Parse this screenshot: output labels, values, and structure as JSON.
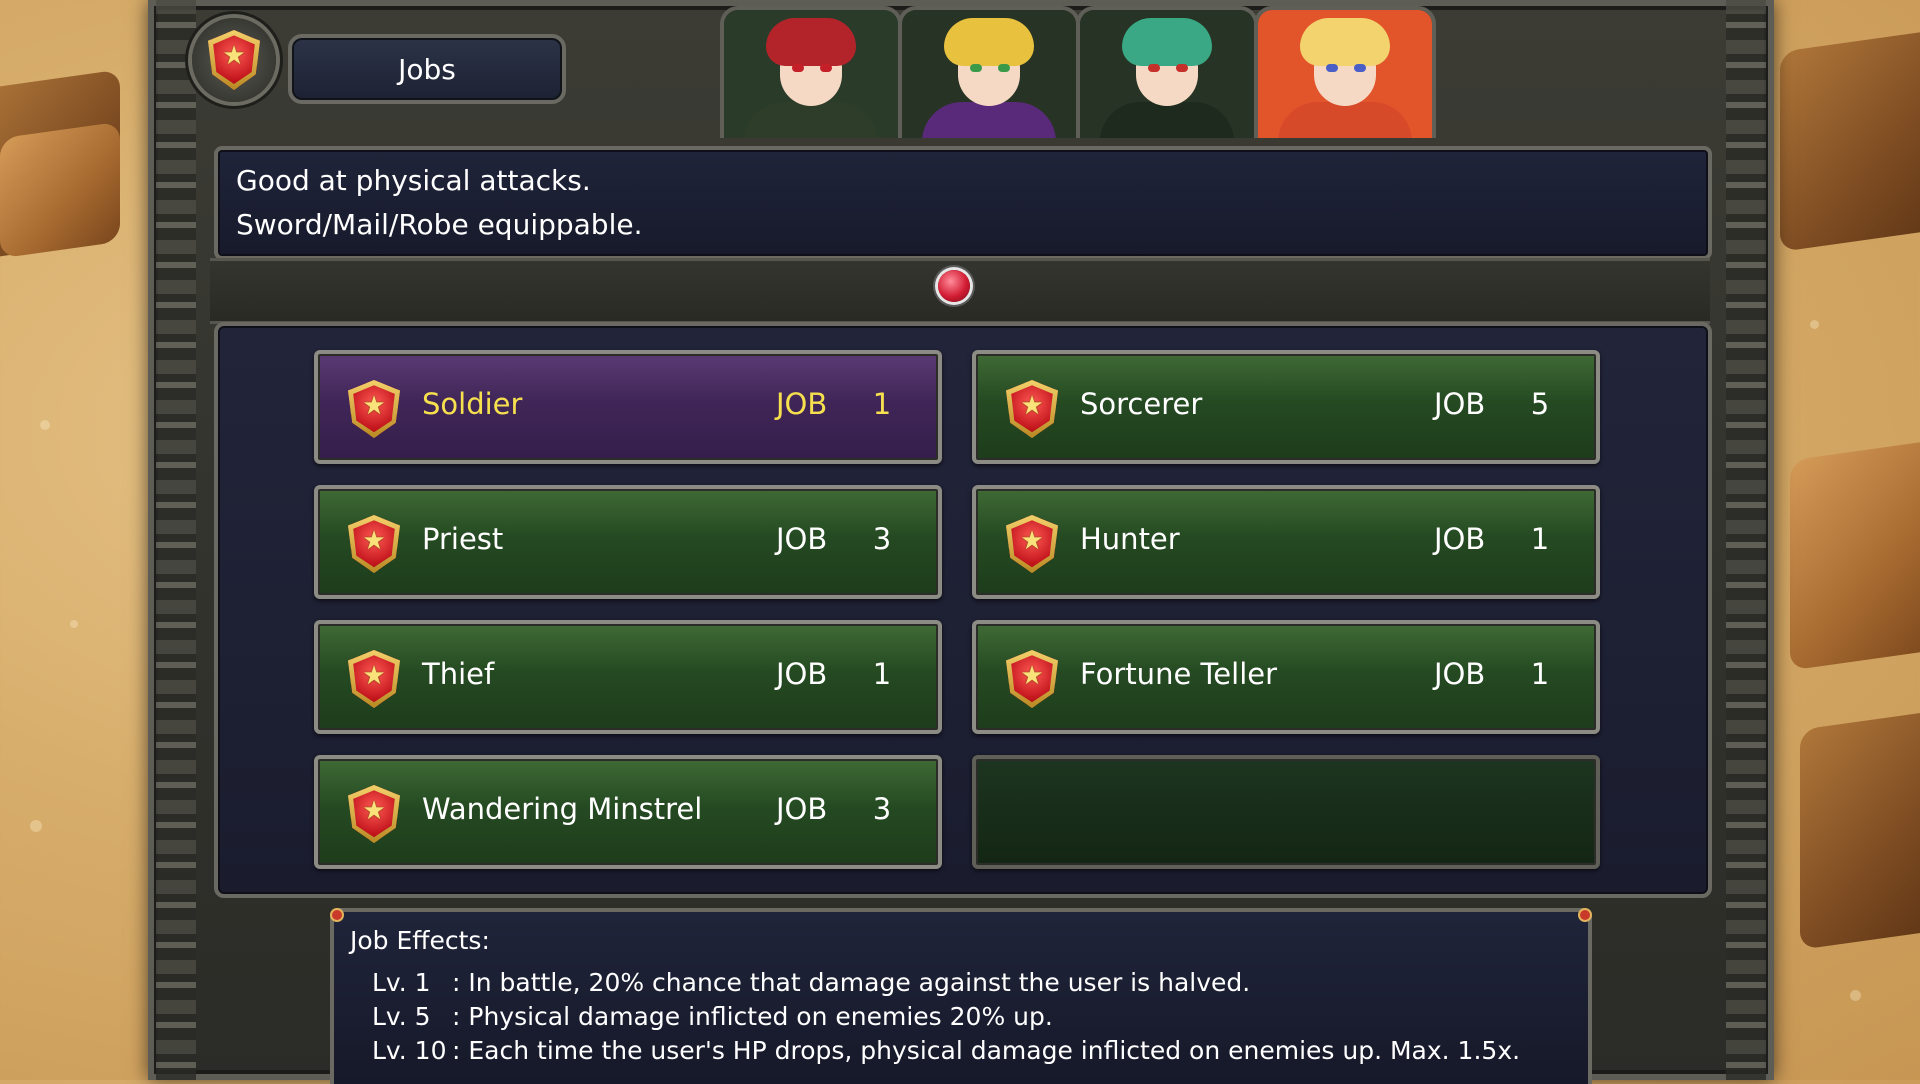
{
  "window": {
    "title": "Jobs"
  },
  "party": [
    {
      "name": "red-haired-hero-portrait",
      "hair": "#b3242a",
      "eye": "#c5202a",
      "outfit": "#2d3d2a",
      "bg": "#2a3b2a"
    },
    {
      "name": "blonde-knight-portrait",
      "hair": "#e8c13e",
      "eye": "#3a9a4a",
      "outfit": "#5a2a7a",
      "bg": "#263325"
    },
    {
      "name": "green-haired-mage-portrait",
      "hair": "#3aa884",
      "eye": "#c5302a",
      "outfit": "#1f2a1e",
      "bg": "#263325"
    },
    {
      "name": "blonde-girl-portrait",
      "hair": "#f2d36e",
      "eye": "#4a5fc5",
      "outfit": "#d64a2a",
      "bg": "#e2542a"
    }
  ],
  "description": {
    "line1": "Good at physical attacks.",
    "line2": "Sword/Mail/Robe equippable."
  },
  "jobs": [
    {
      "name": "Soldier",
      "label": "JOB",
      "level": "1",
      "selected": true
    },
    {
      "name": "Sorcerer",
      "label": "JOB",
      "level": "5",
      "selected": false
    },
    {
      "name": "Priest",
      "label": "JOB",
      "level": "3",
      "selected": false
    },
    {
      "name": "Hunter",
      "label": "JOB",
      "level": "1",
      "selected": false
    },
    {
      "name": "Thief",
      "label": "JOB",
      "level": "1",
      "selected": false
    },
    {
      "name": "Fortune Teller",
      "label": "JOB",
      "level": "1",
      "selected": false
    },
    {
      "name": "Wandering Minstrel",
      "label": "JOB",
      "level": "3",
      "selected": false
    }
  ],
  "effects": {
    "heading": "Job Effects:",
    "rows": [
      {
        "lv": "Lv. 1",
        "text": ": In battle, 20% chance that damage against the user is halved."
      },
      {
        "lv": "Lv. 5",
        "text": ": Physical damage inflicted on enemies 20% up."
      },
      {
        "lv": "Lv. 10",
        "text": ": Each time the user's HP drops, physical damage inflicted on enemies up. Max. 1.5x."
      }
    ]
  },
  "colors": {
    "selected_text": "#f6e04e",
    "selected_bg": "#402658",
    "job_bg": "#254a22",
    "panel_bg": "#1a1c2e"
  },
  "icons": {
    "job": "shield-star-icon",
    "page": "page-indicator-gem"
  }
}
